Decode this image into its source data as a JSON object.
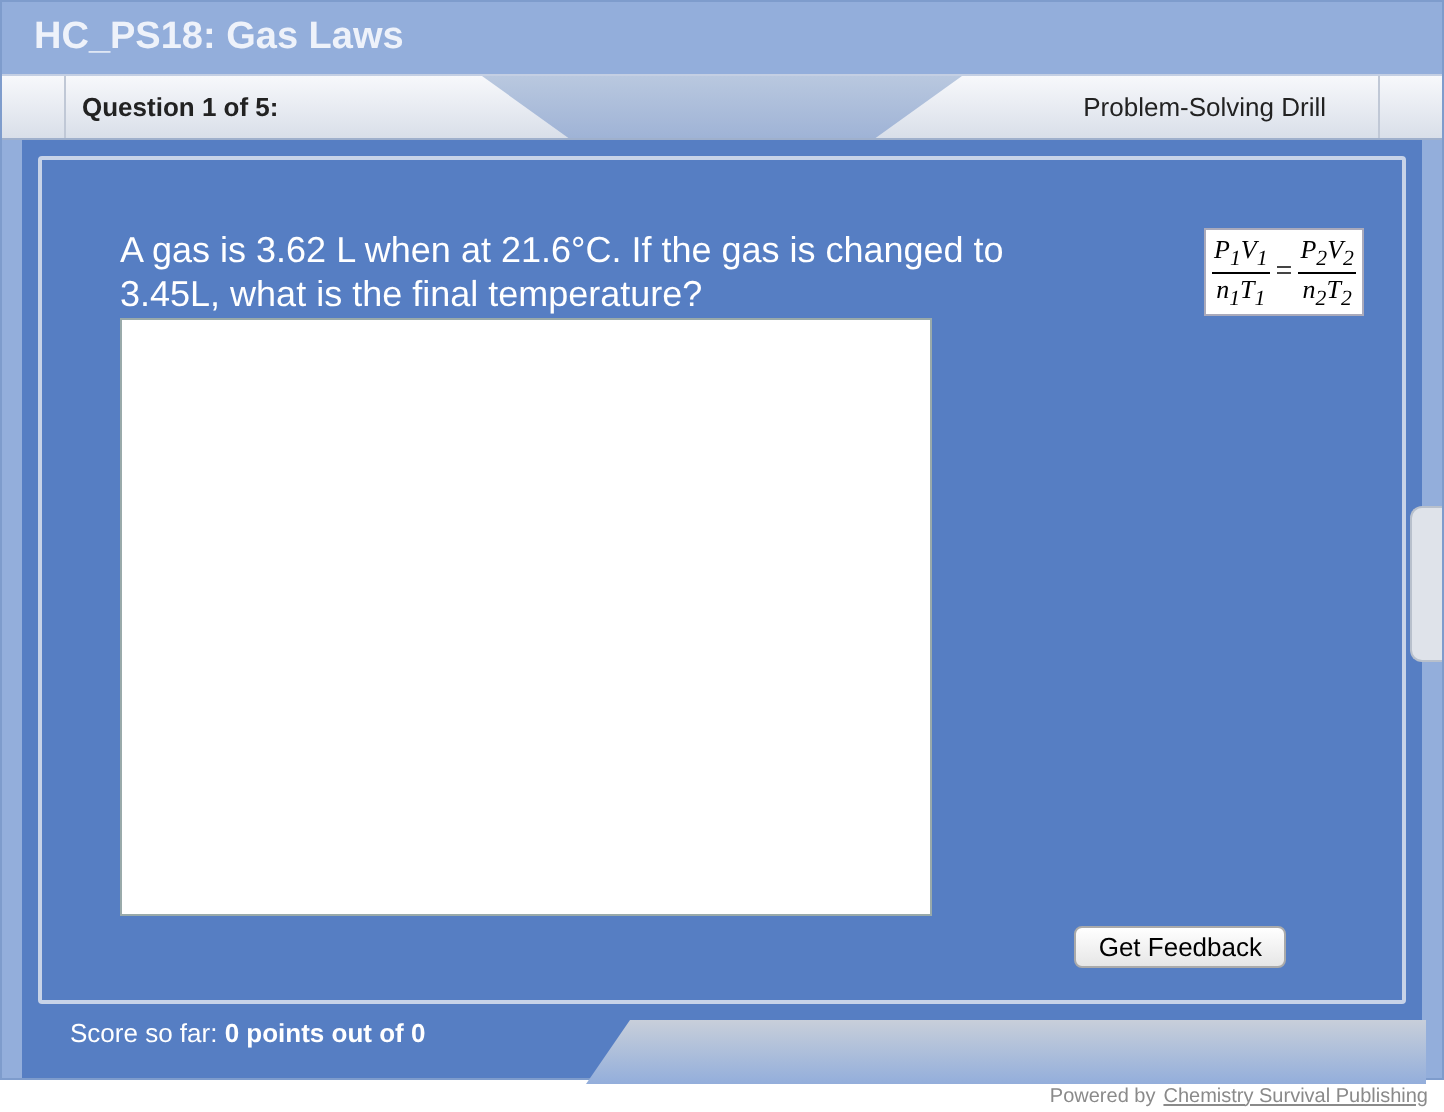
{
  "window": {
    "title": "HC_PS18: Gas Laws"
  },
  "header": {
    "question_counter": "Question 1 of 5:",
    "mode": "Problem-Solving Drill"
  },
  "question": {
    "text": "A gas is 3.62 L when at 21.6°C.  If the gas is changed to 3.45L, what is the final temperature?",
    "formula": {
      "left_numerator": "P$_{1}$V$_{1}$",
      "left_denominator": "n$_{1}$T$_{1}$",
      "operator": "=",
      "right_numerator": "P$_{2}$V$_{2}$",
      "right_denominator": "n$_{2}$T$_{2}$"
    }
  },
  "buttons": [
    "Get Feedback"
  ],
  "score": {
    "label": "Score so far:",
    "value": "0 points out of 0"
  },
  "footer": {
    "powered_by": "Powered by",
    "link": "Chemistry Survival Publishing"
  }
}
